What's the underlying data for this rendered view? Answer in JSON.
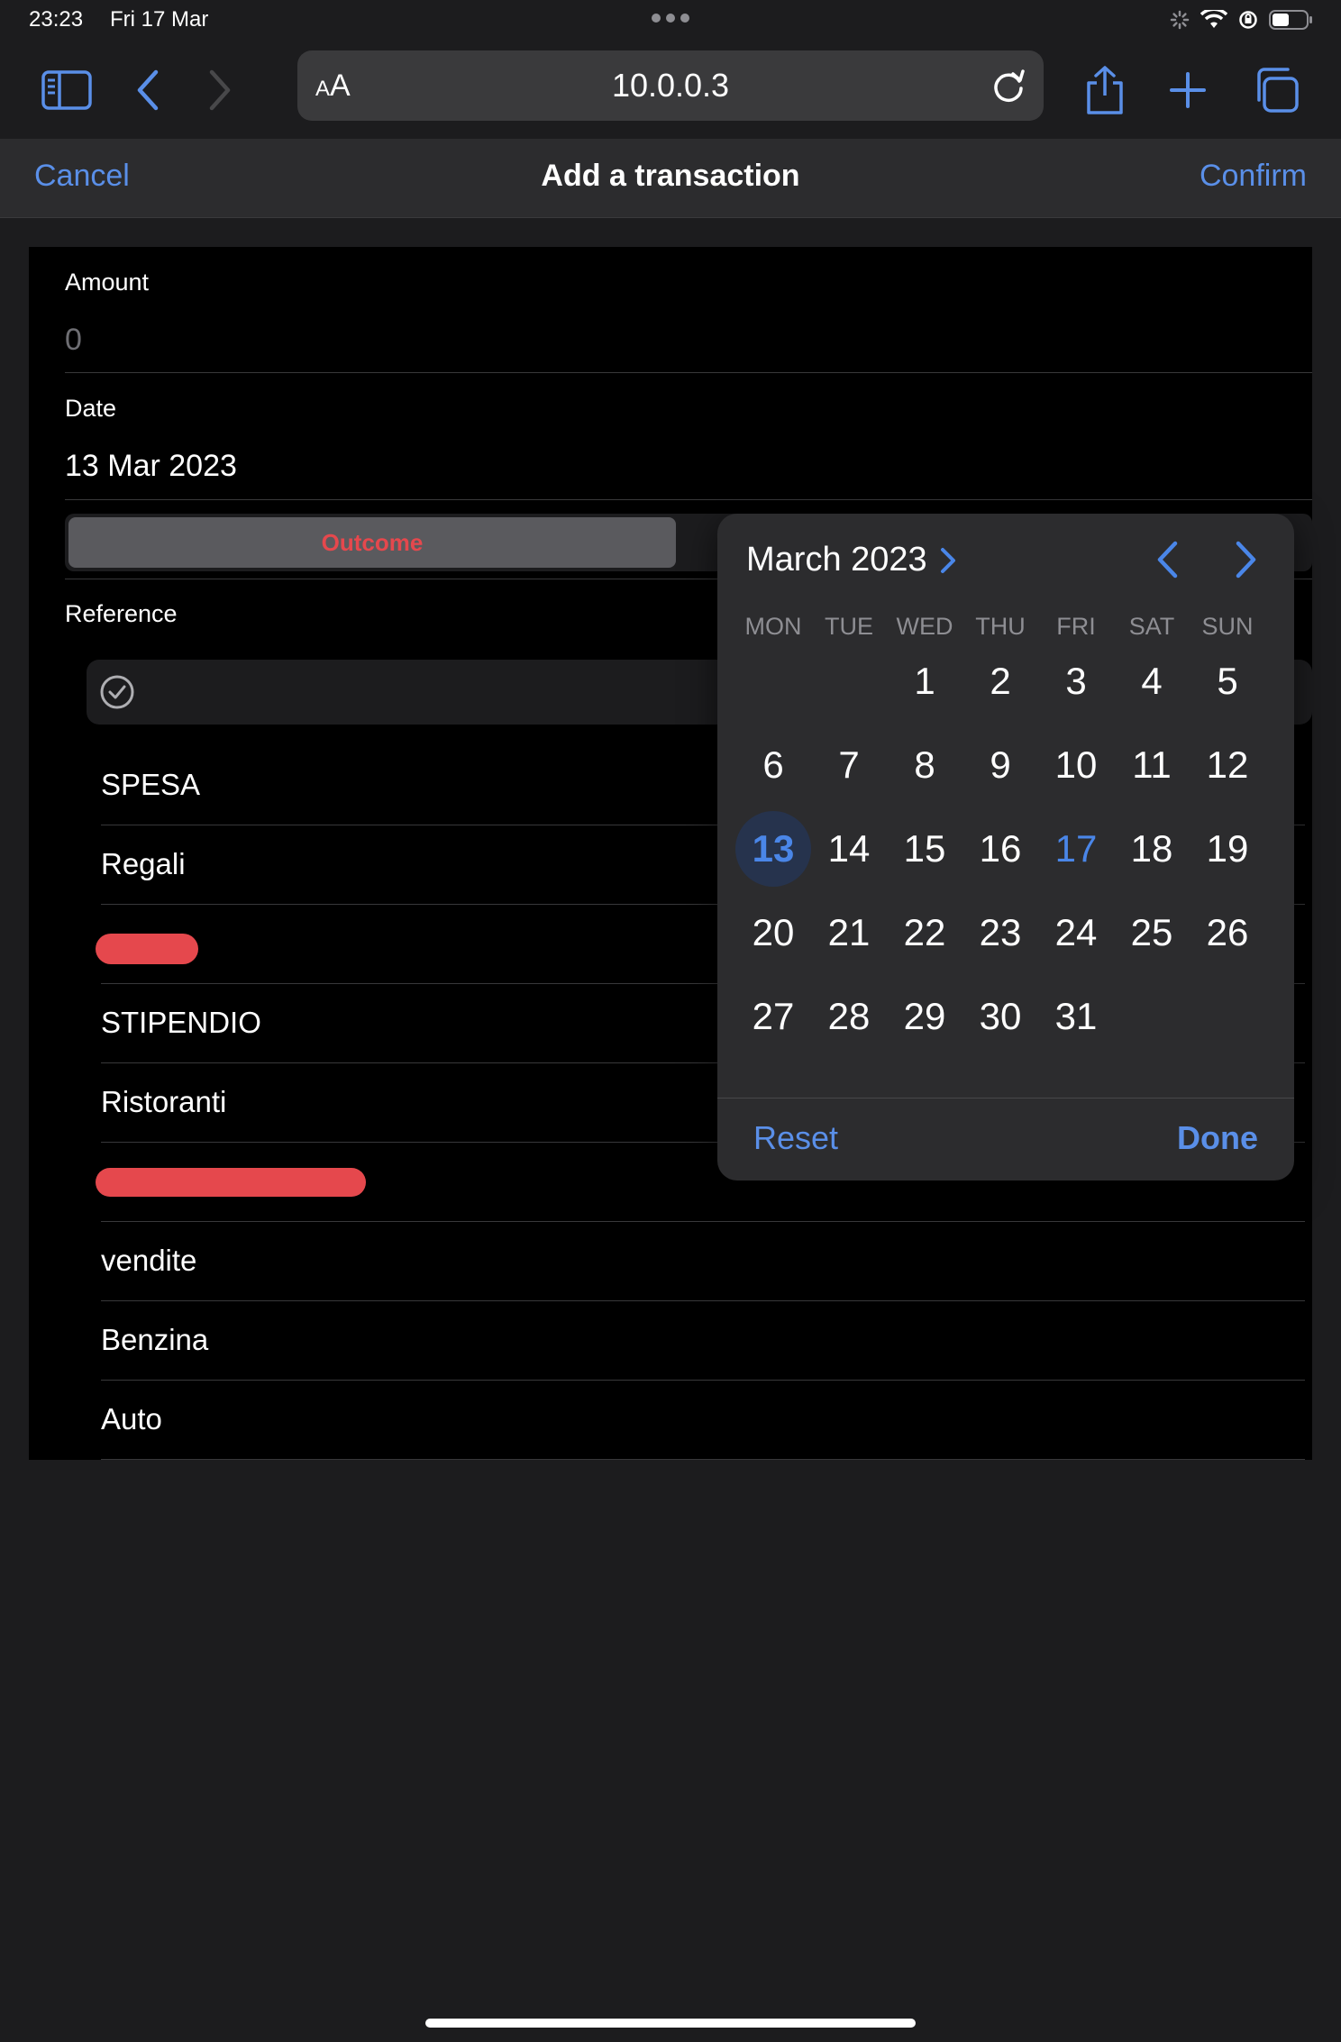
{
  "status": {
    "time": "23:23",
    "date": "Fri 17 Mar"
  },
  "browser": {
    "text_size_label_small": "A",
    "text_size_label_large": "A",
    "url": "10.0.0.3"
  },
  "nav": {
    "cancel": "Cancel",
    "title": "Add a transaction",
    "confirm": "Confirm"
  },
  "form": {
    "amount_label": "Amount",
    "amount_placeholder": "0",
    "date_label": "Date",
    "date_value": "13 Mar 2023",
    "type_selected": "Outcome",
    "reference_label": "Reference",
    "references": [
      "SPESA",
      "Regali",
      "",
      "STIPENDIO",
      "Ristoranti",
      "",
      "vendite",
      "Benzina",
      "Auto"
    ]
  },
  "calendar": {
    "month_label": "March 2023",
    "weekdays": [
      "MON",
      "TUE",
      "WED",
      "THU",
      "FRI",
      "SAT",
      "SUN"
    ],
    "first_weekday_index": 2,
    "days": [
      "1",
      "2",
      "3",
      "4",
      "5",
      "6",
      "7",
      "8",
      "9",
      "10",
      "11",
      "12",
      "13",
      "14",
      "15",
      "16",
      "17",
      "18",
      "19",
      "20",
      "21",
      "22",
      "23",
      "24",
      "25",
      "26",
      "27",
      "28",
      "29",
      "30",
      "31"
    ],
    "selected_day": "13",
    "today": "17",
    "reset": "Reset",
    "done": "Done"
  },
  "colors": {
    "accent": "#5a8fe8",
    "outcome": "#e5484d",
    "background": "#1c1c1e"
  }
}
